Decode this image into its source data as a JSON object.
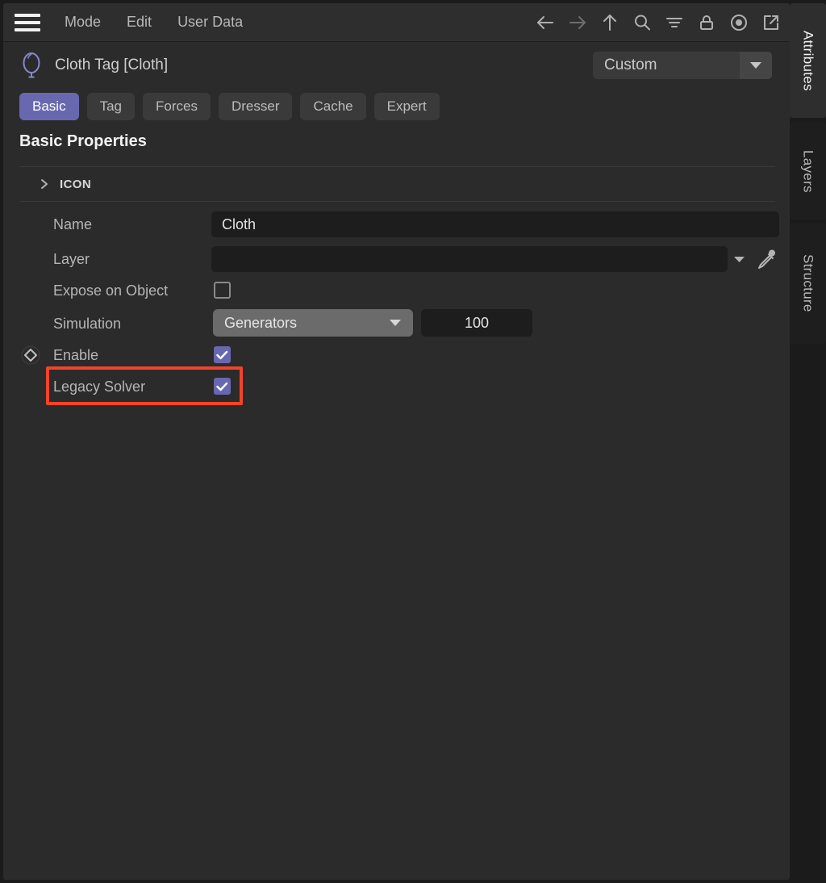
{
  "menubar": {
    "hamburger_icon": "hamburger-menu-icon",
    "items": [
      {
        "label": "Mode"
      },
      {
        "label": "Edit"
      },
      {
        "label": "User Data"
      }
    ],
    "toolbar_icons": [
      {
        "name": "back-arrow-icon",
        "enabled": true
      },
      {
        "name": "forward-arrow-icon",
        "enabled": false
      },
      {
        "name": "up-arrow-icon",
        "enabled": true
      },
      {
        "name": "search-icon",
        "enabled": true
      },
      {
        "name": "filter-icon",
        "enabled": true
      },
      {
        "name": "lock-icon",
        "enabled": true
      },
      {
        "name": "record-target-icon",
        "enabled": true
      },
      {
        "name": "open-external-icon",
        "enabled": true
      }
    ]
  },
  "object_header": {
    "icon": "balloon-icon",
    "title": "Cloth Tag [Cloth]",
    "preset": {
      "value": "Custom",
      "caret_icon": "chevron-down-icon"
    }
  },
  "tabs": [
    {
      "label": "Basic",
      "active": true
    },
    {
      "label": "Tag",
      "active": false
    },
    {
      "label": "Forces",
      "active": false
    },
    {
      "label": "Dresser",
      "active": false
    },
    {
      "label": "Cache",
      "active": false
    },
    {
      "label": "Expert",
      "active": false
    }
  ],
  "section": {
    "title": "Basic Properties",
    "group": {
      "label": "ICON",
      "expanded": false,
      "chevron_icon": "chevron-right-icon"
    }
  },
  "properties": {
    "name": {
      "label": "Name",
      "value": "Cloth"
    },
    "layer": {
      "label": "Layer",
      "value": "",
      "caret_icon": "chevron-down-icon",
      "picker_icon": "eyedropper-icon"
    },
    "expose_on_object": {
      "label": "Expose on Object",
      "checked": false
    },
    "simulation": {
      "label": "Simulation",
      "value": "Generators",
      "caret_icon": "chevron-down-icon",
      "number": "100"
    },
    "enable": {
      "label": "Enable",
      "checked": true,
      "keyframe_icon": "keyframe-diamond-icon"
    },
    "legacy_solver": {
      "label": "Legacy Solver",
      "checked": true,
      "highlighted": true
    }
  },
  "side_tabs": [
    {
      "label": "Attributes",
      "active": true
    },
    {
      "label": "Layers",
      "active": false
    },
    {
      "label": "Structure",
      "active": false
    }
  ],
  "colors": {
    "accent": "#6868b0",
    "highlight": "#f1442a",
    "panel_bg": "#2b2b2b",
    "field_bg": "#1d1d1d"
  }
}
